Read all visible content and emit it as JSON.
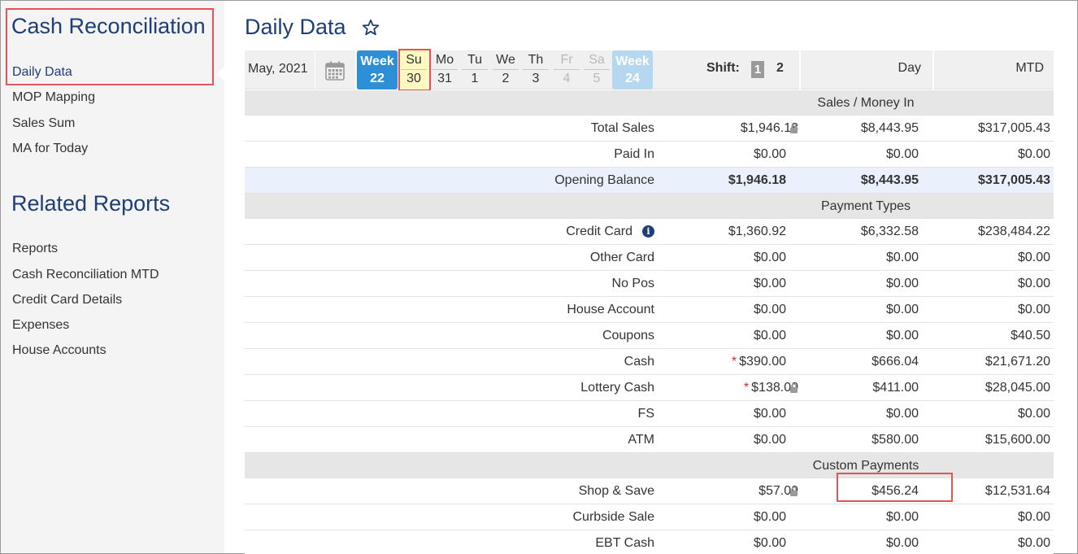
{
  "sidebar": {
    "title": "Cash Reconciliation",
    "items": [
      {
        "label": "Daily Data"
      },
      {
        "label": "MOP Mapping"
      },
      {
        "label": "Sales Sum"
      },
      {
        "label": "MA for Today"
      }
    ],
    "related_title": "Related Reports",
    "related": [
      {
        "label": "Reports"
      },
      {
        "label": "Cash Reconciliation MTD"
      },
      {
        "label": "Credit Card Details"
      },
      {
        "label": "Expenses"
      },
      {
        "label": "House Accounts"
      }
    ]
  },
  "page": {
    "title": "Daily Data"
  },
  "toolbar": {
    "month": "May, 2021",
    "prev_week": {
      "label": "Week",
      "number": "22",
      "color": "#2f8fd6"
    },
    "next_week": {
      "label": "Week",
      "number": "24",
      "color": "#b5d7f0"
    },
    "days": [
      {
        "name": "Su",
        "date": "30"
      },
      {
        "name": "Mo",
        "date": "31"
      },
      {
        "name": "Tu",
        "date": "1"
      },
      {
        "name": "We",
        "date": "2"
      },
      {
        "name": "Th",
        "date": "3"
      },
      {
        "name": "Fr",
        "date": "4"
      },
      {
        "name": "Sa",
        "date": "5"
      }
    ],
    "shift_label": "Shift:",
    "shift_1": "1",
    "shift_2": "2",
    "col_day": "Day",
    "col_mtd": "MTD"
  },
  "sections": {
    "sales": "Sales / Money In",
    "payment": "Payment Types",
    "custom": "Custom Payments"
  },
  "rows": {
    "total_sales": {
      "label": "Total Sales",
      "shift": "$1,946.18",
      "day": "$8,443.95",
      "mtd": "$317,005.43"
    },
    "paid_in": {
      "label": "Paid In",
      "shift": "$0.00",
      "day": "$0.00",
      "mtd": "$0.00"
    },
    "opening_balance": {
      "label": "Opening Balance",
      "shift": "$1,946.18",
      "day": "$8,443.95",
      "mtd": "$317,005.43"
    },
    "credit_card": {
      "label": "Credit Card",
      "shift": "$1,360.92",
      "day": "$6,332.58",
      "mtd": "$238,484.22"
    },
    "other_card": {
      "label": "Other Card",
      "shift": "$0.00",
      "day": "$0.00",
      "mtd": "$0.00"
    },
    "no_pos": {
      "label": "No Pos",
      "shift": "$0.00",
      "day": "$0.00",
      "mtd": "$0.00"
    },
    "house_account": {
      "label": "House Account",
      "shift": "$0.00",
      "day": "$0.00",
      "mtd": "$0.00"
    },
    "coupons": {
      "label": "Coupons",
      "shift": "$0.00",
      "day": "$0.00",
      "mtd": "$40.50"
    },
    "cash": {
      "label": "Cash",
      "asterisk": "*",
      "shift": "$390.00",
      "day": "$666.04",
      "mtd": "$21,671.20"
    },
    "lottery_cash": {
      "label": "Lottery Cash",
      "asterisk": "*",
      "shift": "$138.00",
      "day": "$411.00",
      "mtd": "$28,045.00"
    },
    "fs": {
      "label": "FS",
      "shift": "$0.00",
      "day": "$0.00",
      "mtd": "$0.00"
    },
    "atm": {
      "label": "ATM",
      "shift": "$0.00",
      "day": "$580.00",
      "mtd": "$15,600.00"
    },
    "shop_save": {
      "label": "Shop & Save",
      "shift": "$57.09",
      "day": "$456.24",
      "mtd": "$12,531.64"
    },
    "curbside": {
      "label": "Curbside Sale",
      "shift": "$0.00",
      "day": "$0.00",
      "mtd": "$0.00"
    },
    "ebt_cash": {
      "label": "EBT Cash",
      "shift": "$0.00",
      "day": "$0.00",
      "mtd": "$0.00"
    }
  },
  "icons": {
    "star": "star-outline-icon",
    "calendar": "calendar-icon",
    "lock": "lock-icon",
    "info": "info-icon"
  },
  "colors": {
    "heading": "#1d3f75",
    "highlight_border": "#e05555",
    "selected_day": "#fff8c0",
    "asterisk": "#d62a2a"
  }
}
